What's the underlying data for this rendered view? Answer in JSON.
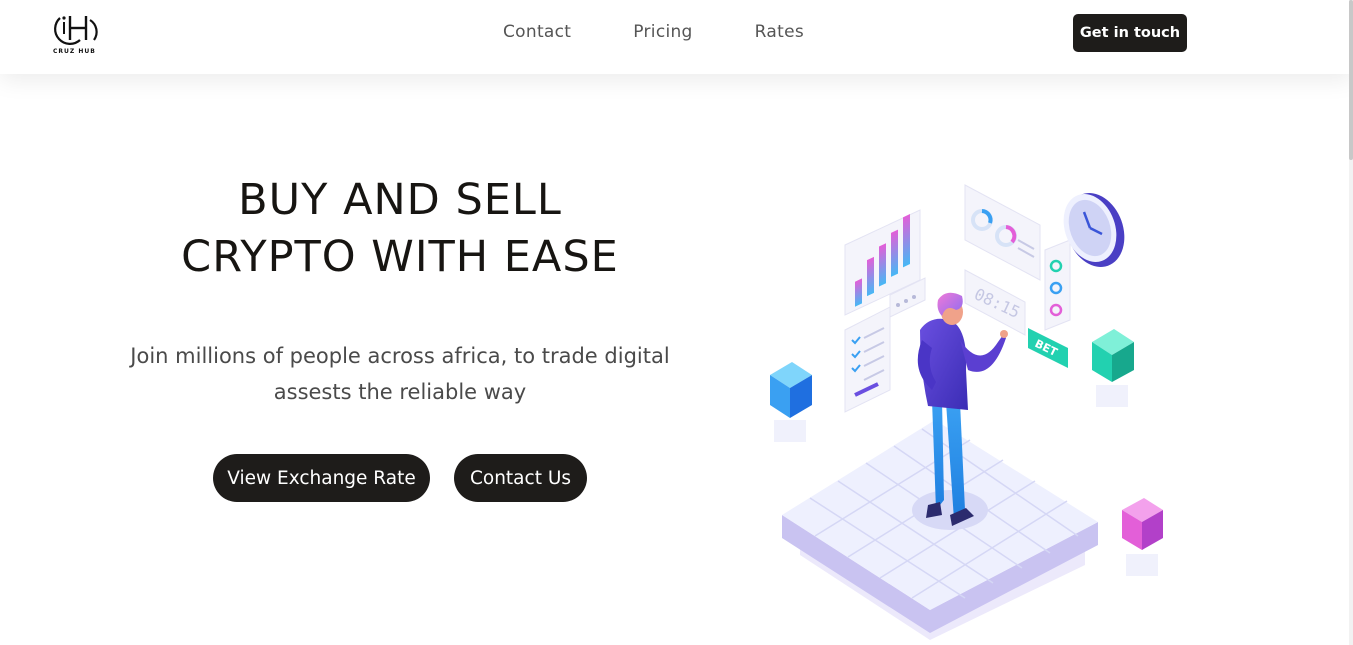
{
  "brand": {
    "logo_text": "CRUZ HUB"
  },
  "nav": {
    "links": [
      {
        "label": "Contact"
      },
      {
        "label": "Pricing"
      },
      {
        "label": "Rates"
      }
    ],
    "cta_label": "Get in touch"
  },
  "hero": {
    "title_line1": "BUY AND SELL",
    "title_line2": "CRYPTO WITH EASE",
    "subtitle": "Join millions of people across africa, to trade digital assests the reliable way",
    "primary_button": "View Exchange Rate",
    "secondary_button": "Contact Us"
  },
  "illustration": {
    "time_display": "08:15",
    "bet_tag": "BET"
  },
  "colors": {
    "button_dark": "#1e1c1a",
    "text_dark": "#171512",
    "text_muted": "#4a4a4a",
    "accent_blue": "#3aa0f2",
    "accent_purple": "#5b3fd1",
    "accent_pink": "#e35fd8",
    "accent_teal": "#22d1b0"
  }
}
